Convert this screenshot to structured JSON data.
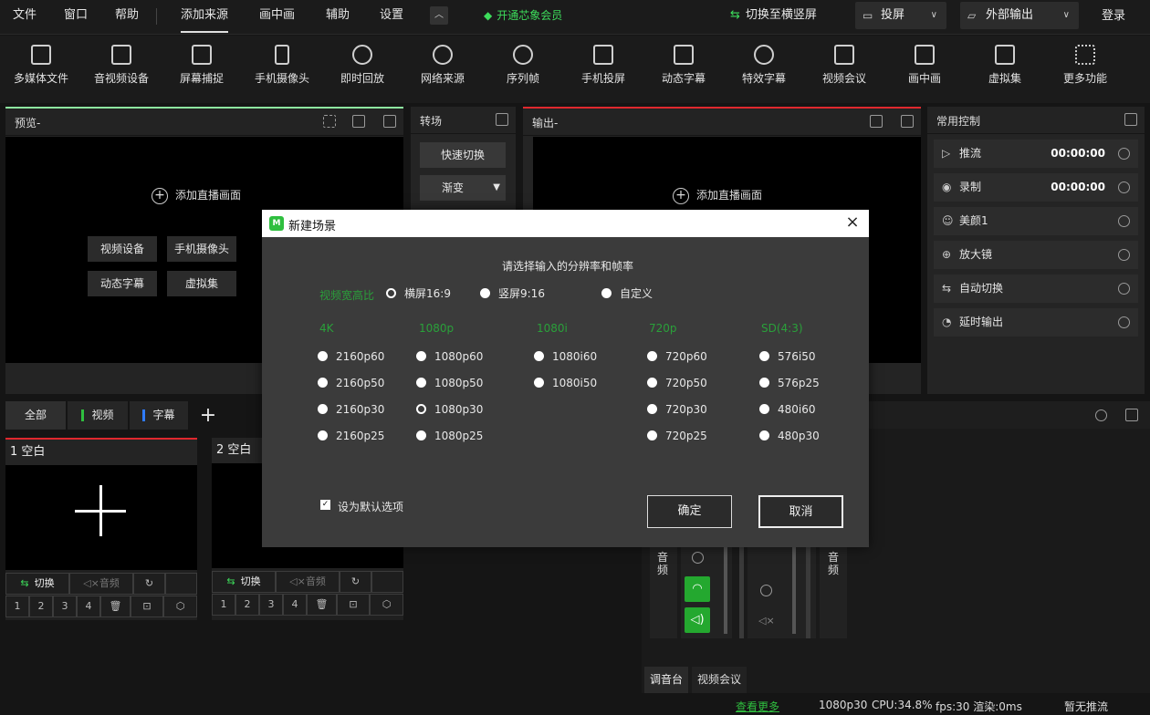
{
  "menubar": {
    "file": "文件",
    "window": "窗口",
    "help": "帮助",
    "add_source": "添加来源",
    "pip": "画中画",
    "assist": "辅助",
    "settings": "设置",
    "vip": "开通芯象会员",
    "switch_portrait": "切换至横竖屏",
    "cast_label": "投屏",
    "external_output": "外部输出",
    "login": "登录"
  },
  "toolbar": {
    "items": [
      {
        "label": "多媒体文件",
        "icon": "media-file-icon"
      },
      {
        "label": "音视频设备",
        "icon": "av-device-icon"
      },
      {
        "label": "屏幕捕捉",
        "icon": "screen-capture-icon"
      },
      {
        "label": "手机摄像头",
        "icon": "phone-camera-icon"
      },
      {
        "label": "即时回放",
        "icon": "instant-replay-icon"
      },
      {
        "label": "网络来源",
        "icon": "network-source-icon"
      },
      {
        "label": "序列帧",
        "icon": "sequence-frame-icon"
      },
      {
        "label": "手机投屏",
        "icon": "phone-cast-icon"
      },
      {
        "label": "动态字幕",
        "icon": "dynamic-subtitle-icon"
      },
      {
        "label": "特效字幕",
        "icon": "effect-subtitle-icon"
      },
      {
        "label": "视频会议",
        "icon": "video-conference-icon"
      },
      {
        "label": "画中画",
        "icon": "pip-icon"
      },
      {
        "label": "虚拟集",
        "icon": "virtual-set-icon"
      },
      {
        "label": "更多功能",
        "icon": "more-features-icon"
      }
    ]
  },
  "preview": {
    "title": "预览-",
    "add_live": "添加直播画面",
    "quick_buttons": [
      "视频设备",
      "手机摄像头",
      "动态字幕",
      "虚拟集"
    ]
  },
  "transition": {
    "title": "转场",
    "quick_switch": "快速切换",
    "fade": "渐变"
  },
  "output": {
    "title": "输出-",
    "add_live": "添加直播画面"
  },
  "controls": {
    "title": "常用控制",
    "items": [
      {
        "label": "推流",
        "time": "00:00:00",
        "icon": "play-icon"
      },
      {
        "label": "录制",
        "time": "00:00:00",
        "icon": "record-icon"
      },
      {
        "label": "美颜1",
        "time": "",
        "icon": "beauty-icon"
      },
      {
        "label": "放大镜",
        "time": "",
        "icon": "magnifier-icon"
      },
      {
        "label": "自动切换",
        "time": "",
        "icon": "auto-switch-icon"
      },
      {
        "label": "延时输出",
        "time": "",
        "icon": "delay-icon"
      }
    ]
  },
  "scene_tabs": {
    "all": "全部",
    "video": "视频",
    "subtitle": "字幕"
  },
  "scenes": [
    {
      "title": "1 空白",
      "switch": "切换",
      "audio": "音频",
      "nums": [
        "1",
        "2",
        "3",
        "4"
      ]
    },
    {
      "title": "2 空白",
      "switch": "切换",
      "audio": "音频",
      "nums": [
        "1",
        "2",
        "3",
        "4"
      ]
    }
  ],
  "mixer": {
    "left_label": "音频",
    "right_label": "音频",
    "tabs": [
      "调音台",
      "视频会议"
    ]
  },
  "status": {
    "more": "查看更多",
    "resolution": "1080p30",
    "cpu": "CPU:34.8%",
    "fps": "fps:30 渲染:0ms",
    "stream_state": "暂无推流"
  },
  "dialog": {
    "title": "新建场景",
    "prompt": "请选择输入的分辨率和帧率",
    "aspect_label": "视频宽高比",
    "aspect_options": [
      {
        "label": "横屏16:9",
        "selected": true
      },
      {
        "label": "竖屏9:16",
        "selected": false
      },
      {
        "label": "自定义",
        "selected": false
      }
    ],
    "groups": [
      {
        "name": "4K",
        "options": [
          "2160p60",
          "2160p50",
          "2160p30",
          "2160p25"
        ]
      },
      {
        "name": "1080p",
        "options": [
          "1080p60",
          "1080p50",
          "1080p30",
          "1080p25"
        ]
      },
      {
        "name": "1080i",
        "options": [
          "1080i60",
          "1080i50"
        ]
      },
      {
        "name": "720p",
        "options": [
          "720p60",
          "720p50",
          "720p30",
          "720p25"
        ]
      },
      {
        "name": "SD(4:3)",
        "options": [
          "576i50",
          "576p25",
          "480i60",
          "480p30"
        ]
      }
    ],
    "selected_format": "1080p30",
    "default_checkbox": "设为默认选项",
    "default_checked": true,
    "ok": "确定",
    "cancel": "取消"
  },
  "colors": {
    "accent_green": "#2fbf3f",
    "live_red": "#e0282e",
    "preview_green": "#8de6a0"
  }
}
